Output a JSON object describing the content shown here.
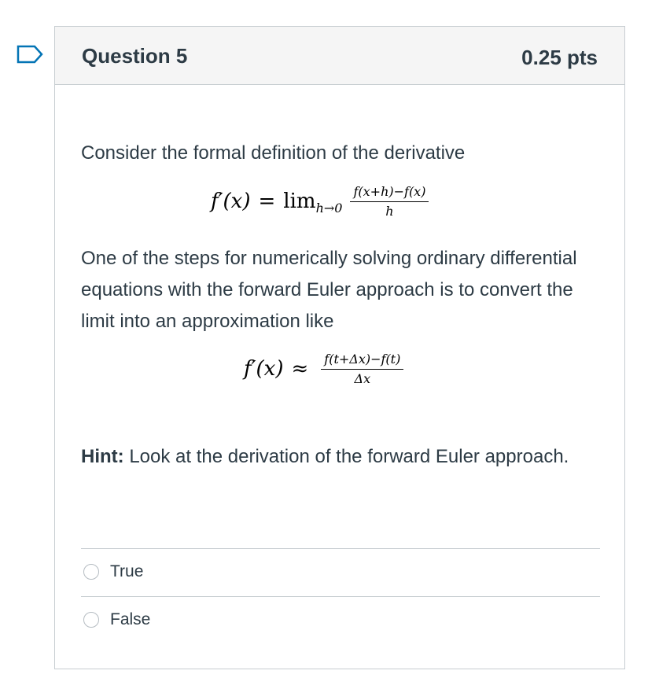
{
  "question": {
    "title": "Question 5",
    "points": "0.25 pts",
    "intro": "Consider the formal definition of the derivative",
    "eq1": {
      "lhs": "f′(x)",
      "eq": "=",
      "lim": "lim",
      "sub": "h→0",
      "numerator": "f(x+h)−f(x)",
      "denominator": "h"
    },
    "paragraph": "One of the steps for numerically solving ordinary differential equations with the forward Euler approach is to convert the limit into an approximation like",
    "eq2": {
      "lhs": "f′(x)",
      "approx": "≈",
      "numerator": "f(t+Δx)−f(t)",
      "denominator": "Δx"
    },
    "hint_label": "Hint:",
    "hint_text": " Look at the derivation of the forward Euler approach."
  },
  "answers": [
    {
      "label": "True"
    },
    {
      "label": "False"
    }
  ],
  "colors": {
    "text": "#2d3b45",
    "border": "#c7cdd1",
    "header_bg": "#f5f5f5",
    "bookmark": "#0374b5"
  },
  "icons": {
    "bookmark": "bookmark-flag-icon",
    "radio": "radio-unchecked-icon"
  }
}
